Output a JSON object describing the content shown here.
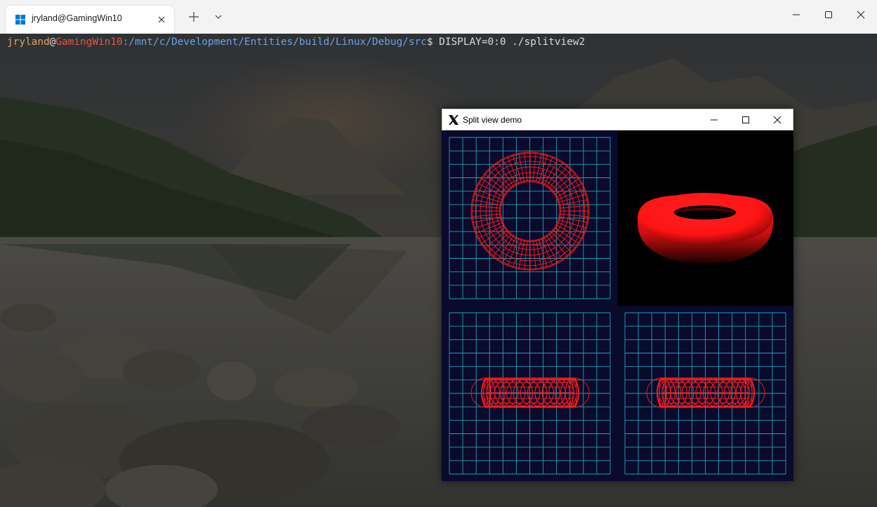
{
  "terminal_app": {
    "tab_title": "jryland@GamingWin10",
    "tab_icon": "windows-logo-icon",
    "prompt": {
      "user": "jryland",
      "at": "@",
      "host": "GamingWin10",
      "path": ":/mnt/c/Development/Entities/build/Linux/Debug/src",
      "symbol": "$",
      "command": " DISPLAY=0:0 ./splitview2"
    }
  },
  "x_window": {
    "title": "Split view demo",
    "icon": "x11-logo-icon",
    "viewports": [
      {
        "name": "top-view",
        "style": "wireframe",
        "projection": "top"
      },
      {
        "name": "perspective-view",
        "style": "shaded",
        "projection": "perspective"
      },
      {
        "name": "front-view",
        "style": "wireframe",
        "projection": "front"
      },
      {
        "name": "side-view",
        "style": "wireframe",
        "projection": "side"
      }
    ]
  },
  "colors": {
    "viewport_bg": "#0a0a2c",
    "grid": "#1fa3b3",
    "torus": "#ff1a1a",
    "perspective_bg": "#000000"
  }
}
